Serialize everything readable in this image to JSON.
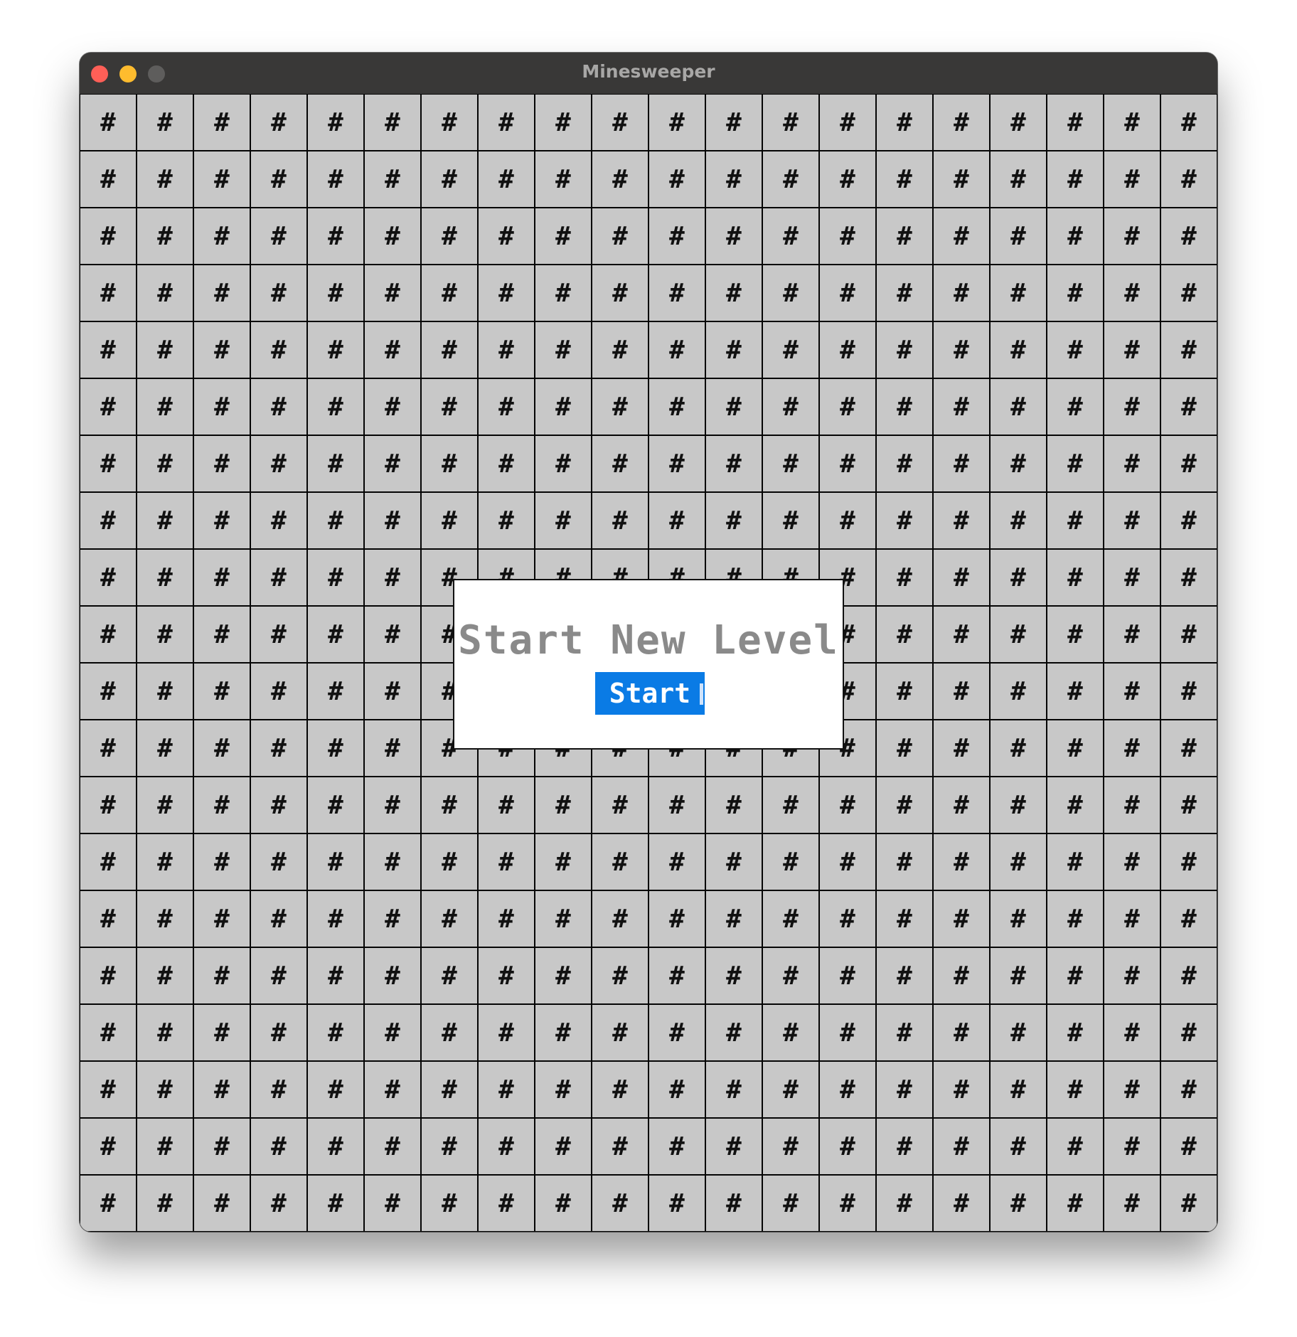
{
  "window": {
    "title": "Minesweeper"
  },
  "board": {
    "rows": 20,
    "columns": 20,
    "cell_symbol": "#",
    "cell_color": "#c8c8c8",
    "grid_line_color": "#000000"
  },
  "dialog": {
    "title": "Start New Level",
    "button_label": "Start",
    "button_color": "#0a7be5"
  },
  "colors": {
    "close": "#fe5f57",
    "minimize": "#febc2e",
    "maximize": "#5e5d5c",
    "titlebar": "#393837"
  }
}
